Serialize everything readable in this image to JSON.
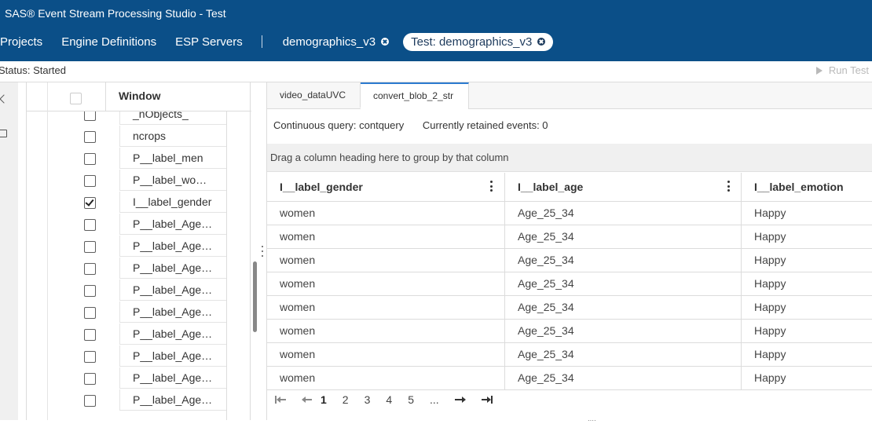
{
  "window": {
    "title": "SAS® Event Stream Processing Studio - Test"
  },
  "nav": {
    "items": [
      "Projects",
      "Engine Definitions",
      "ESP Servers"
    ],
    "doc_tabs": [
      {
        "label": "demographics_v3",
        "active": false
      },
      {
        "label": "Test: demographics_v3",
        "active": true
      }
    ]
  },
  "status": {
    "text": "Status: Started",
    "run_test_label": "Run Test"
  },
  "left_panel": {
    "header_label": "Window",
    "rows": [
      {
        "label": "_nObjects_",
        "checked": false
      },
      {
        "label": "ncrops",
        "checked": false
      },
      {
        "label": "P__label_men",
        "checked": false
      },
      {
        "label": "P__label_wo…",
        "checked": false
      },
      {
        "label": "I__label_gender",
        "checked": true
      },
      {
        "label": "P__label_Age…",
        "checked": false
      },
      {
        "label": "P__label_Age…",
        "checked": false
      },
      {
        "label": "P__label_Age…",
        "checked": false
      },
      {
        "label": "P__label_Age…",
        "checked": false
      },
      {
        "label": "P__label_Age…",
        "checked": false
      },
      {
        "label": "P__label_Age…",
        "checked": false
      },
      {
        "label": "P__label_Age…",
        "checked": false
      },
      {
        "label": "P__label_Age…",
        "checked": false
      },
      {
        "label": "P__label_Age…",
        "checked": false
      }
    ]
  },
  "right_panel": {
    "tabs": [
      "video_dataUVC",
      "convert_blob_2_str"
    ],
    "active_tab": 1,
    "cq_label": "Continuous query: contquery",
    "retained_label": "Currently retained events: 0",
    "group_hint": "Drag a column heading here to group by that column",
    "columns": [
      "I__label_gender",
      "I__label_age",
      "I__label_emotion"
    ],
    "rows": [
      [
        "women",
        "Age_25_34",
        "Happy"
      ],
      [
        "women",
        "Age_25_34",
        "Happy"
      ],
      [
        "women",
        "Age_25_34",
        "Happy"
      ],
      [
        "women",
        "Age_25_34",
        "Happy"
      ],
      [
        "women",
        "Age_25_34",
        "Happy"
      ],
      [
        "women",
        "Age_25_34",
        "Happy"
      ],
      [
        "women",
        "Age_25_34",
        "Happy"
      ],
      [
        "women",
        "Age_25_34",
        "Happy"
      ]
    ],
    "pager": {
      "pages": [
        "1",
        "2",
        "3",
        "4",
        "5",
        "..."
      ],
      "current": "1"
    }
  },
  "colors": {
    "topbar": "#0b4f88",
    "accent": "#2d7bd0"
  }
}
